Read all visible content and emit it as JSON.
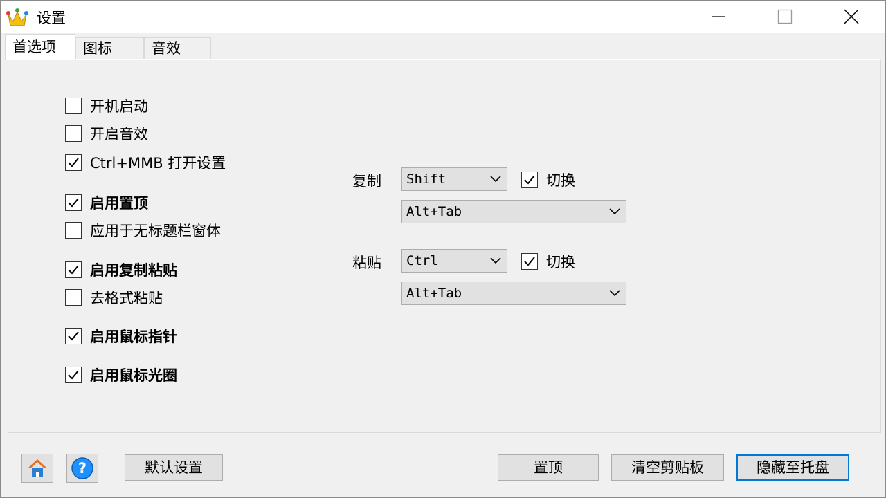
{
  "window": {
    "title": "设置"
  },
  "tabs": [
    {
      "label": "首选项",
      "active": true
    },
    {
      "label": "图标",
      "active": false
    },
    {
      "label": "音效",
      "active": false
    }
  ],
  "options": [
    {
      "label": "开机启动",
      "checked": false,
      "bold": false
    },
    {
      "label": "开启音效",
      "checked": false,
      "bold": false
    },
    {
      "label": "Ctrl+MMB 打开设置",
      "checked": true,
      "bold": false
    },
    {
      "label": "启用置顶",
      "checked": true,
      "bold": true
    },
    {
      "label": "应用于无标题栏窗体",
      "checked": false,
      "bold": false
    },
    {
      "label": "启用复制粘贴",
      "checked": true,
      "bold": true
    },
    {
      "label": "去格式粘贴",
      "checked": false,
      "bold": false
    },
    {
      "label": "启用鼠标指针",
      "checked": true,
      "bold": true
    },
    {
      "label": "启用鼠标光圈",
      "checked": true,
      "bold": true
    }
  ],
  "hotkeys": {
    "copy": {
      "label": "复制",
      "modifier": "Shift",
      "toggle_label": "切换",
      "toggle_checked": true,
      "combo": "Alt+Tab"
    },
    "paste": {
      "label": "粘贴",
      "modifier": "Ctrl",
      "toggle_label": "切换",
      "toggle_checked": true,
      "combo": "Alt+Tab"
    }
  },
  "footer": {
    "default_label": "默认设置",
    "pin_label": "置顶",
    "clear_label": "清空剪贴板",
    "hide_label": "隐藏至托盘"
  },
  "colors": {
    "accent": "#0078d7",
    "help_icon": "#1e90ff",
    "home_roof": "#e07020"
  }
}
